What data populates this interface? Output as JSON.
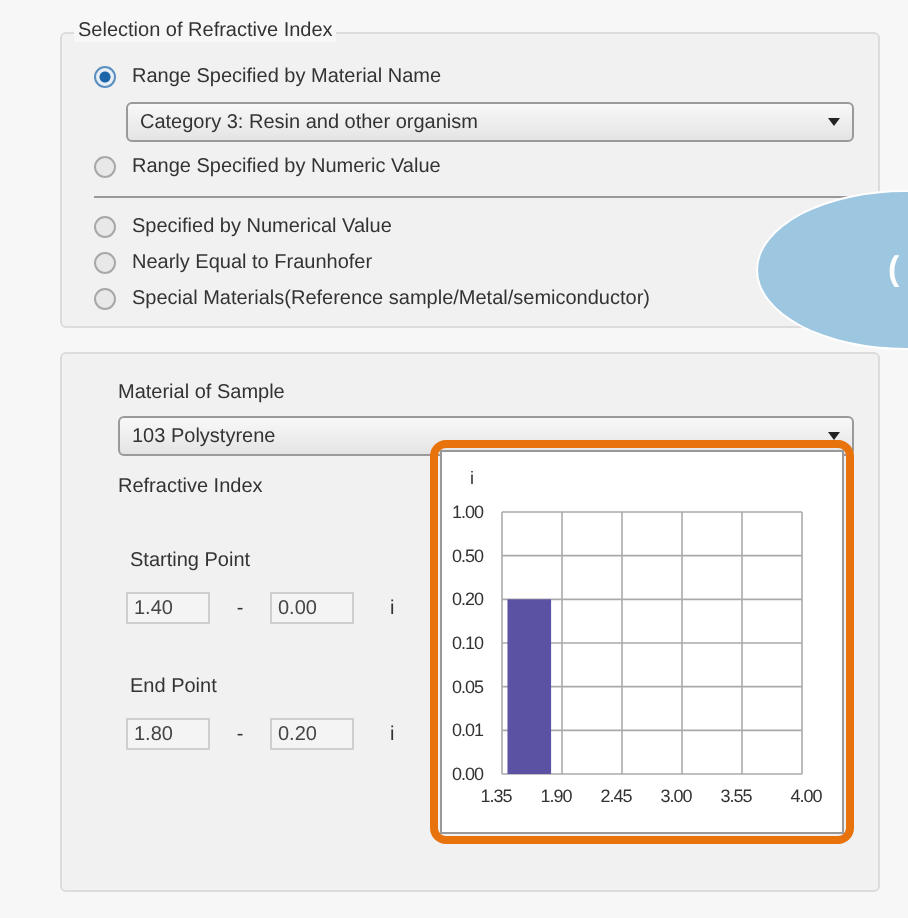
{
  "selection_group": {
    "title": "Selection of Refractive Index",
    "options": [
      {
        "label": "Range Specified by Material Name",
        "selected": true,
        "kind": "radio"
      },
      {
        "kind": "dropdown",
        "value": "Category 3: Resin and other organism"
      },
      {
        "label": "Range Specified by Numeric Value",
        "selected": false,
        "kind": "radio"
      },
      {
        "kind": "separator"
      },
      {
        "label": "Specified by Numerical Value",
        "selected": false,
        "kind": "radio"
      },
      {
        "label": "Nearly Equal to Fraunhofer",
        "selected": false,
        "kind": "radio"
      },
      {
        "label": "Special Materials(Reference sample/Metal/semiconductor)",
        "selected": false,
        "kind": "radio"
      }
    ]
  },
  "callout": {
    "text": "("
  },
  "material": {
    "label": "Material of Sample",
    "value": "103 Polystyrene",
    "refractive_label": "Refractive Index",
    "points": [
      {
        "label": "Starting Point",
        "real": "1.40",
        "dash": "-",
        "imag": "0.00",
        "unit": "i"
      },
      {
        "label": "End Point",
        "real": "1.80",
        "dash": "-",
        "imag": "0.20",
        "unit": "i"
      }
    ],
    "range_chart": {
      "y_axis_label": "i",
      "x_tick_labels": [
        "1.35",
        "1.90",
        "2.45",
        "3.00",
        "3.55",
        "4.00"
      ],
      "y_tick_labels": [
        "1.00",
        "0.50",
        "0.20",
        "0.10",
        "0.05",
        "0.01",
        "0.00"
      ]
    }
  }
}
